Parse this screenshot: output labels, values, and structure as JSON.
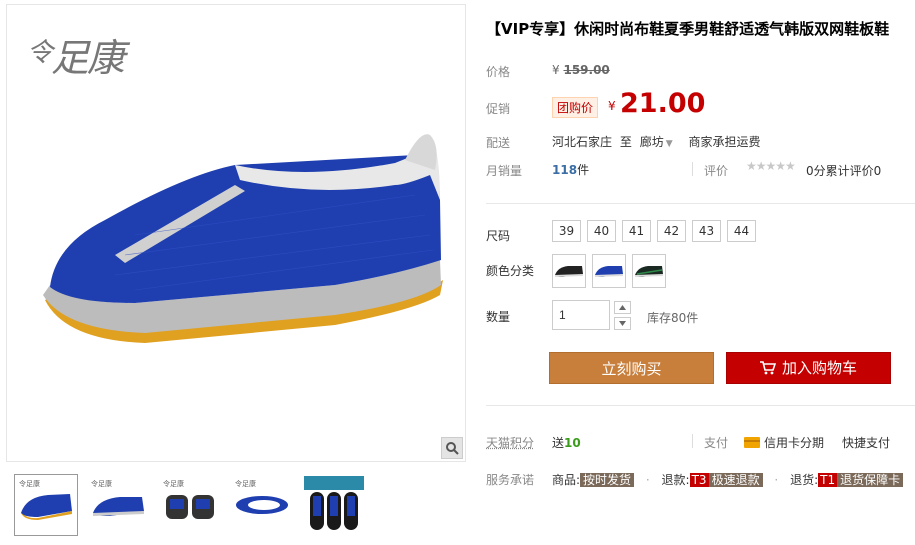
{
  "product": {
    "title": "【VIP专享】休闲时尚布鞋夏季男鞋舒适透气韩版双网鞋板鞋",
    "brand_logo_small": "令",
    "brand_logo": "足康"
  },
  "labels": {
    "price": "价格",
    "promo": "促销",
    "shipping": "配送",
    "monthly_sales": "月销量",
    "size": "尺码",
    "color": "颜色分类",
    "quantity": "数量",
    "points": "天猫积分",
    "service": "服务承诺"
  },
  "price": {
    "currency": "¥",
    "original": "159.00",
    "promo_tag": "团购价",
    "promo_price": "21.00"
  },
  "shipping": {
    "from": "河北石家庄",
    "to_word": "至",
    "to": "廊坊",
    "fee": "商家承担运费"
  },
  "sales": {
    "count": "118",
    "unit": "件",
    "review_label": "评价",
    "stars": "★★★★★",
    "review_count": "0分累计评价0"
  },
  "sizes": [
    "39",
    "40",
    "41",
    "42",
    "43",
    "44"
  ],
  "colors": [
    "black-white",
    "blue",
    "black-green"
  ],
  "quantity": {
    "value": "1",
    "stock": "库存80件"
  },
  "actions": {
    "buy_now": "立刻购买",
    "add_to_cart": "加入购物车"
  },
  "points": {
    "prefix": "送",
    "value": "10"
  },
  "payment": {
    "label": "支付",
    "credit": "信用卡分期",
    "quick": "快捷支付"
  },
  "service": {
    "goods_label": "商品:",
    "goods_tag": "按时发货",
    "refund_label": "退款:",
    "refund_code": "T3",
    "refund_tag": "极速退款",
    "return_label": "退货:",
    "return_code": "T1",
    "return_tag": "退货保障卡"
  },
  "thumbnails": [
    "blue-shoe-side",
    "blue-shoe-angle",
    "shoe-pair-back",
    "blue-shoe-top",
    "promo-pair"
  ],
  "colors_theme": {
    "accent_red": "#c40000",
    "buy_orange": "#c87f3c",
    "shoe_blue": "#1f3fb0"
  }
}
